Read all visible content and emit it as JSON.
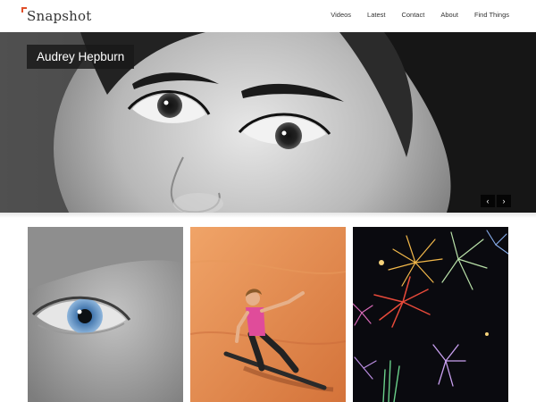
{
  "site": {
    "logo_text": "Snapshot",
    "accent": "#e0502a"
  },
  "nav": {
    "items": [
      "Videos",
      "Latest",
      "Contact",
      "About",
      "Find Things"
    ]
  },
  "hero": {
    "caption": "Audrey Hepburn",
    "prev_symbol": "‹",
    "next_symbol": "›"
  },
  "thumbnails": [
    {
      "subject": "blue-eye-closeup"
    },
    {
      "subject": "sandboarder-on-dune"
    },
    {
      "subject": "fireworks-at-night"
    }
  ]
}
